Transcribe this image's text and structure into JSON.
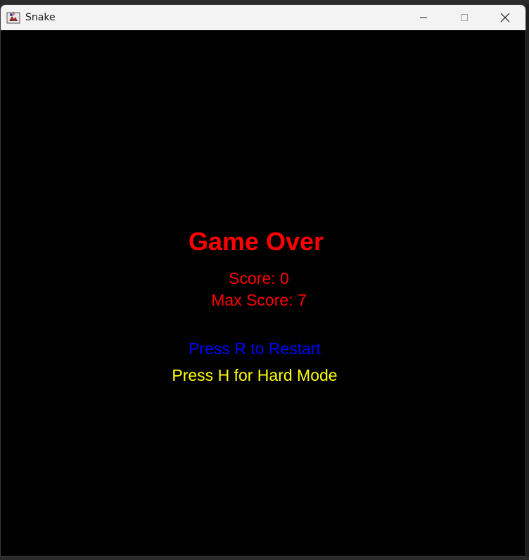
{
  "window": {
    "title": "Snake",
    "icons": {
      "app": "java-app-icon",
      "minimize": "minimize-icon",
      "maximize": "maximize-icon",
      "close": "close-icon"
    }
  },
  "game": {
    "title": "Game Over",
    "score_text": "Score: 0",
    "max_score_text": "Max Score: 7",
    "restart_text": "Press R to Restart",
    "hard_mode_text": "Press H for Hard Mode",
    "score": 0,
    "max_score": 7
  },
  "colors": {
    "background": "#000000",
    "game_over": "#ff0000",
    "score": "#ff0000",
    "restart": "#0000ff",
    "hard_mode": "#ffff00",
    "titlebar": "#f3f3f3"
  }
}
